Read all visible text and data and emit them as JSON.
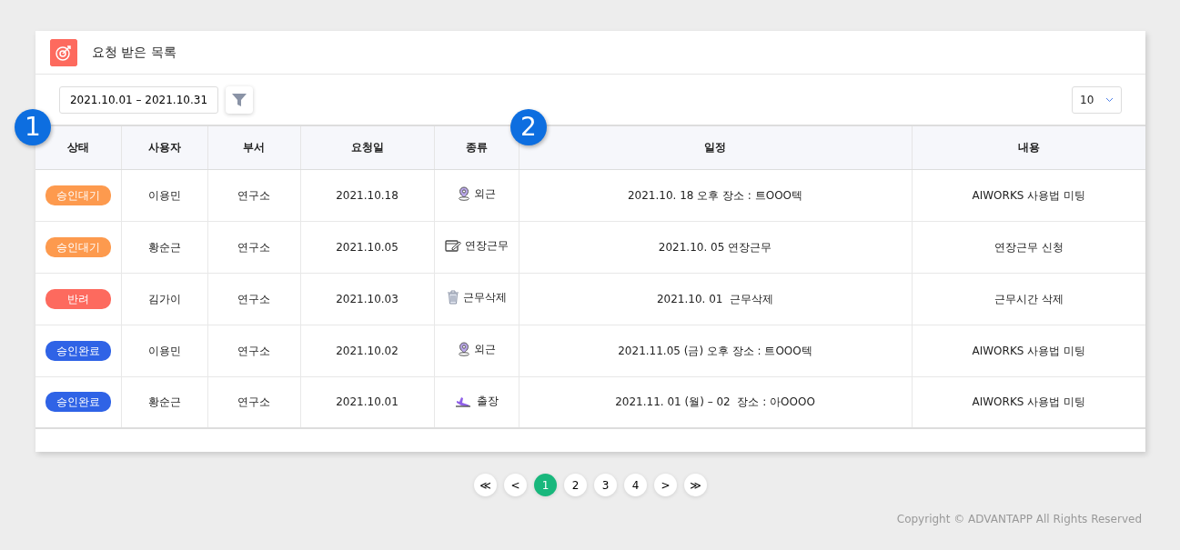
{
  "panel": {
    "title": "요청 받은 목록"
  },
  "toolbar": {
    "date_range": "2021.10.01 – 2021.10.31",
    "page_size": "10"
  },
  "table": {
    "columns": [
      "상태",
      "사용자",
      "부서",
      "요청일",
      "종류",
      "일정",
      "내용"
    ],
    "rows": [
      {
        "status": "승인대기",
        "color": "#fd9a4e",
        "user": "이용민",
        "dept": "연구소",
        "date": "2021.10.18",
        "kind": "location",
        "type": "외근",
        "schedule": "2021.10. 18 오후 장소 : 트OOO텍",
        "content": "AIWORKS 사용법 미팅"
      },
      {
        "status": "승인대기",
        "color": "#fd9a4e",
        "user": "황순근",
        "dept": "연구소",
        "date": "2021.10.05",
        "kind": "edit",
        "type": "연장근무",
        "schedule": "2021.10. 05 연장근무",
        "content": "연장근무 신청"
      },
      {
        "status": "반려",
        "color": "#fd6a5e",
        "user": "김가이",
        "dept": "연구소",
        "date": "2021.10.03",
        "kind": "trash",
        "type": "근무삭제",
        "schedule": "2021.10. 01  근무삭제",
        "content": "근무시간 삭제"
      },
      {
        "status": "승인완료",
        "color": "#2f63e6",
        "user": "이용민",
        "dept": "연구소",
        "date": "2021.10.02",
        "kind": "location",
        "type": "외근",
        "schedule": "2021.11.05 (금) 오후 장소 : 트OOO텍",
        "content": "AIWORKS 사용법 미팅"
      },
      {
        "status": "승인완료",
        "color": "#2f63e6",
        "user": "황순근",
        "dept": "연구소",
        "date": "2021.10.01",
        "kind": "plane",
        "type": "출장",
        "schedule": "2021.11. 01 (월) – 02  장소 : 아OOOO",
        "content": "AIWORKS 사용법 미팅"
      }
    ]
  },
  "pagination": [
    {
      "label": "≪",
      "selected": false
    },
    {
      "label": "<",
      "selected": false
    },
    {
      "label": "1",
      "selected": true
    },
    {
      "label": "2",
      "selected": false
    },
    {
      "label": "3",
      "selected": false
    },
    {
      "label": "4",
      "selected": false
    },
    {
      "label": ">",
      "selected": false
    },
    {
      "label": "≫",
      "selected": false
    }
  ],
  "callouts": [
    "1",
    "2"
  ],
  "footer": "Copyright © ADVANTAPP All Rights Reserved"
}
